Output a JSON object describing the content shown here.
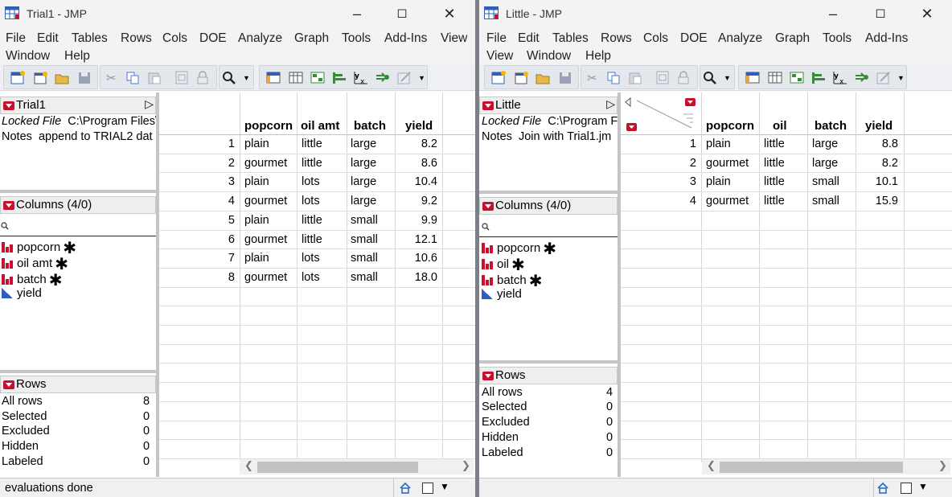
{
  "windows": [
    {
      "title": "Trial1 - JMP",
      "menus_row1": [
        "File",
        "Edit",
        "Tables",
        "Rows",
        "Cols",
        "DOE",
        "Analyze",
        "Graph",
        "Tools",
        "Add-Ins",
        "View"
      ],
      "menus_row2": [
        "Window",
        "Help"
      ],
      "table_name": "Trial1",
      "locked_file_label": "Locked File",
      "locked_file_path": "C:\\Program Files\\",
      "notes_label": "Notes",
      "notes_text": "append to TRIAL2 dat",
      "columns_header": "Columns (4/0)",
      "search_icon": "search-icon",
      "columns": [
        {
          "name": "popcorn",
          "type": "nominal",
          "star": "✱"
        },
        {
          "name": "oil amt",
          "type": "nominal",
          "star": "✱"
        },
        {
          "name": "batch",
          "type": "nominal",
          "star": "✱"
        },
        {
          "name": "yield",
          "type": "continuous",
          "star": ""
        }
      ],
      "rows_header": "Rows",
      "row_stats": [
        {
          "label": "All rows",
          "value": "8"
        },
        {
          "label": "Selected",
          "value": "0"
        },
        {
          "label": "Excluded",
          "value": "0"
        },
        {
          "label": "Hidden",
          "value": "0"
        },
        {
          "label": "Labeled",
          "value": "0"
        }
      ],
      "grid_headers": [
        "popcorn",
        "oil amt",
        "batch",
        "yield"
      ],
      "grid_rows": [
        [
          "1",
          "plain",
          "little",
          "large",
          "8.2"
        ],
        [
          "2",
          "gourmet",
          "little",
          "large",
          "8.6"
        ],
        [
          "3",
          "plain",
          "lots",
          "large",
          "10.4"
        ],
        [
          "4",
          "gourmet",
          "lots",
          "large",
          "9.2"
        ],
        [
          "5",
          "plain",
          "little",
          "small",
          "9.9"
        ],
        [
          "6",
          "gourmet",
          "little",
          "small",
          "12.1"
        ],
        [
          "7",
          "plain",
          "lots",
          "small",
          "10.6"
        ],
        [
          "8",
          "gourmet",
          "lots",
          "small",
          "18.0"
        ]
      ],
      "status_text": "evaluations done"
    },
    {
      "title": "Little - JMP",
      "menus_row1": [
        "File",
        "Edit",
        "Tables",
        "Rows",
        "Cols",
        "DOE",
        "Analyze",
        "Graph",
        "Tools",
        "Add-Ins"
      ],
      "menus_row2": [
        "View",
        "Window",
        "Help"
      ],
      "table_name": "Little",
      "locked_file_label": "Locked File",
      "locked_file_path": "C:\\Program F",
      "notes_label": "Notes",
      "notes_text": "Join with Trial1.jm",
      "columns_header": "Columns (4/0)",
      "search_icon": "search-icon",
      "columns": [
        {
          "name": "popcorn",
          "type": "nominal",
          "star": "✱"
        },
        {
          "name": "oil",
          "type": "nominal",
          "star": "✱"
        },
        {
          "name": "batch",
          "type": "nominal",
          "star": "✱"
        },
        {
          "name": "yield",
          "type": "continuous",
          "star": ""
        }
      ],
      "rows_header": "Rows",
      "row_stats": [
        {
          "label": "All rows",
          "value": "4"
        },
        {
          "label": "Selected",
          "value": "0"
        },
        {
          "label": "Excluded",
          "value": "0"
        },
        {
          "label": "Hidden",
          "value": "0"
        },
        {
          "label": "Labeled",
          "value": "0"
        }
      ],
      "grid_headers": [
        "popcorn",
        "oil",
        "batch",
        "yield"
      ],
      "grid_rows": [
        [
          "1",
          "plain",
          "little",
          "large",
          "8.8"
        ],
        [
          "2",
          "gourmet",
          "little",
          "large",
          "8.2"
        ],
        [
          "3",
          "plain",
          "little",
          "small",
          "10.1"
        ],
        [
          "4",
          "gourmet",
          "little",
          "small",
          "15.9"
        ]
      ],
      "status_text": ""
    }
  ],
  "colors": {
    "jmp_red": "#c8102e",
    "continuous_blue": "#2f5fb8",
    "window_divider": "#7a7f88"
  }
}
